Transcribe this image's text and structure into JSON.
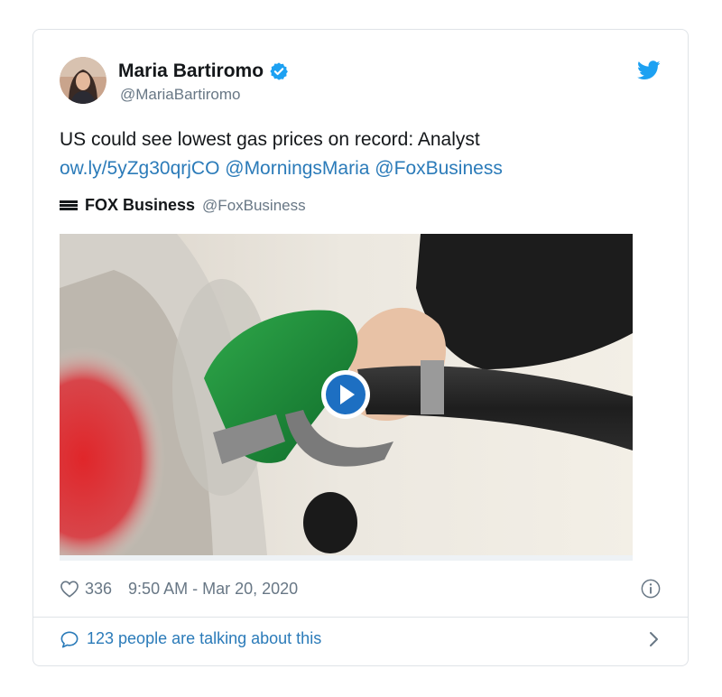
{
  "author": {
    "display_name": "Maria Bartiromo",
    "handle": "@MariaBartiromo",
    "verified": true,
    "avatar_icon": "avatar-photo"
  },
  "tweet": {
    "text": "US could see lowest gas prices on record: Analyst",
    "link": "ow.ly/5yZg30qrjCO",
    "mentions": [
      "@MorningsMaria",
      "@FoxBusiness"
    ]
  },
  "source": {
    "logo_icon": "fox-business-logo",
    "name": "FOX Business",
    "handle": "@FoxBusiness"
  },
  "media": {
    "kind": "video",
    "play_icon": "play-icon"
  },
  "meta": {
    "likes": "336",
    "timestamp": "9:50 AM - Mar 20, 2020"
  },
  "talking": {
    "label": "123 people are talking about this"
  },
  "colors": {
    "link": "#2b7bb9",
    "twitter_blue": "#1da1f2",
    "secondary_text": "#687785",
    "border": "#dfe3e7"
  }
}
